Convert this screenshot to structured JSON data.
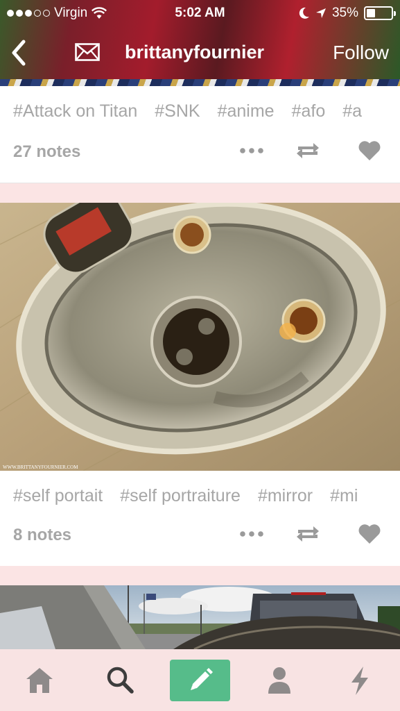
{
  "status_bar": {
    "carrier": "Virgin",
    "time": "5:02 AM",
    "battery": "35%",
    "battery_level": 0.35
  },
  "header": {
    "blog_name": "brittanyfournier",
    "follow_label": "Follow"
  },
  "posts": [
    {
      "tags": [
        "#Attack on Titan",
        "#SNK",
        "#anime",
        "#afo",
        "#a"
      ],
      "notes": "27 notes"
    },
    {
      "tags": [
        "#self portait",
        "#self portraiture",
        "#mirror",
        "#mi"
      ],
      "notes": "8 notes",
      "watermark": "WWW.BRITTANYFOURNIER.COM"
    }
  ],
  "colors": {
    "tag_gray": "#a6a6a6",
    "compose_green": "#56bc8a",
    "feed_background": "#fbe4e4",
    "tabbar_background": "#f8e3e3"
  },
  "icons": {
    "tabbar": [
      "home-icon",
      "search-icon",
      "pencil-icon",
      "person-icon",
      "lightning-icon"
    ]
  }
}
